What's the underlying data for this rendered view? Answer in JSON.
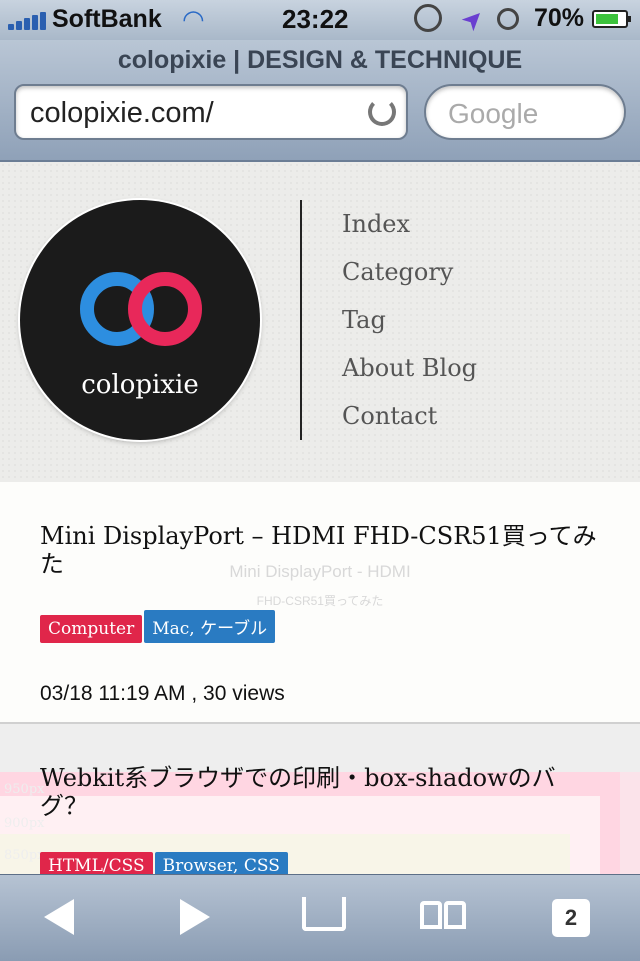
{
  "status_bar": {
    "carrier": "SoftBank",
    "time": "23:22",
    "battery": "70%"
  },
  "browser": {
    "page_title": "colopixie | DESIGN & TECHNIQUE",
    "url": "colopixie.com/",
    "search_placeholder": "Google",
    "tab_count": "2"
  },
  "header": {
    "logo_text": "colopixie",
    "menu": [
      "Index",
      "Category",
      "Tag",
      "About Blog",
      "Contact"
    ]
  },
  "posts": [
    {
      "title": "Mini DisplayPort – HDMI FHD-CSR51買ってみた",
      "thumb_line1": "Mini DisplayPort - HDMI",
      "thumb_line2": "FHD-CSR51買ってみた",
      "tags": [
        {
          "label": "Computer",
          "color": "#e0264a"
        },
        {
          "label": "Mac, ケーブル",
          "color": "#2a7bc2"
        }
      ],
      "meta": "03/18 11:19 AM , 30 views"
    },
    {
      "title": "Webkit系ブラウザでの印刷・box-shadowのバグ？",
      "thumb_labels": [
        "950px",
        "900px",
        "850px"
      ],
      "tags": [
        {
          "label": "HTML/CSS",
          "color": "#e0264a"
        },
        {
          "label": "Browser, CSS",
          "color": "#2a7bc2"
        }
      ]
    }
  ]
}
